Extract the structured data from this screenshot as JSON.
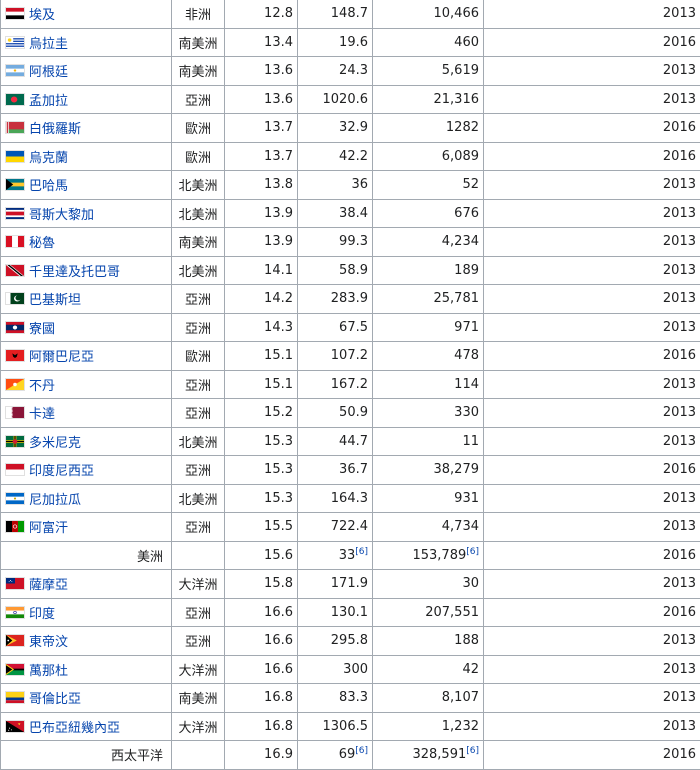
{
  "rows": [
    {
      "kind": "country",
      "name": "埃及",
      "flag": "egypt",
      "continent": "非洲",
      "v1": "12.8",
      "v2": "148.7",
      "v3": "10,466",
      "year": "2013"
    },
    {
      "kind": "country",
      "name": "烏拉圭",
      "flag": "uruguay",
      "continent": "南美洲",
      "v1": "13.4",
      "v2": "19.6",
      "v3": "460",
      "year": "2016"
    },
    {
      "kind": "country",
      "name": "阿根廷",
      "flag": "argentina",
      "continent": "南美洲",
      "v1": "13.6",
      "v2": "24.3",
      "v3": "5,619",
      "year": "2013"
    },
    {
      "kind": "country",
      "name": "孟加拉",
      "flag": "bangladesh",
      "continent": "亞洲",
      "v1": "13.6",
      "v2": "1020.6",
      "v3": "21,316",
      "year": "2013"
    },
    {
      "kind": "country",
      "name": "白俄羅斯",
      "flag": "belarus",
      "continent": "歐洲",
      "v1": "13.7",
      "v2": "32.9",
      "v3": "1282",
      "year": "2016"
    },
    {
      "kind": "country",
      "name": "烏克蘭",
      "flag": "ukraine",
      "continent": "歐洲",
      "v1": "13.7",
      "v2": "42.2",
      "v3": "6,089",
      "year": "2016"
    },
    {
      "kind": "country",
      "name": "巴哈馬",
      "flag": "bahamas",
      "continent": "北美洲",
      "v1": "13.8",
      "v2": "36",
      "v3": "52",
      "year": "2013"
    },
    {
      "kind": "country",
      "name": "哥斯大黎加",
      "flag": "costarica",
      "continent": "北美洲",
      "v1": "13.9",
      "v2": "38.4",
      "v3": "676",
      "year": "2013"
    },
    {
      "kind": "country",
      "name": "秘魯",
      "flag": "peru",
      "continent": "南美洲",
      "v1": "13.9",
      "v2": "99.3",
      "v3": "4,234",
      "year": "2013"
    },
    {
      "kind": "country",
      "name": "千里達及托巴哥",
      "flag": "trinidad",
      "continent": "北美洲",
      "v1": "14.1",
      "v2": "58.9",
      "v3": "189",
      "year": "2013"
    },
    {
      "kind": "country",
      "name": "巴基斯坦",
      "flag": "pakistan",
      "continent": "亞洲",
      "v1": "14.2",
      "v2": "283.9",
      "v3": "25,781",
      "year": "2013"
    },
    {
      "kind": "country",
      "name": "寮國",
      "flag": "laos",
      "continent": "亞洲",
      "v1": "14.3",
      "v2": "67.5",
      "v3": "971",
      "year": "2013"
    },
    {
      "kind": "country",
      "name": "阿爾巴尼亞",
      "flag": "albania",
      "continent": "歐洲",
      "v1": "15.1",
      "v2": "107.2",
      "v3": "478",
      "year": "2016"
    },
    {
      "kind": "country",
      "name": "不丹",
      "flag": "bhutan",
      "continent": "亞洲",
      "v1": "15.1",
      "v2": "167.2",
      "v3": "114",
      "year": "2013"
    },
    {
      "kind": "country",
      "name": "卡達",
      "flag": "qatar",
      "continent": "亞洲",
      "v1": "15.2",
      "v2": "50.9",
      "v3": "330",
      "year": "2013"
    },
    {
      "kind": "country",
      "name": "多米尼克",
      "flag": "dominica",
      "continent": "北美洲",
      "v1": "15.3",
      "v2": "44.7",
      "v3": "11",
      "year": "2013"
    },
    {
      "kind": "country",
      "name": "印度尼西亞",
      "flag": "indonesia",
      "continent": "亞洲",
      "v1": "15.3",
      "v2": "36.7",
      "v3": "38,279",
      "year": "2016"
    },
    {
      "kind": "country",
      "name": "尼加拉瓜",
      "flag": "nicaragua",
      "continent": "北美洲",
      "v1": "15.3",
      "v2": "164.3",
      "v3": "931",
      "year": "2013"
    },
    {
      "kind": "country",
      "name": "阿富汗",
      "flag": "afghanistan",
      "continent": "亞洲",
      "v1": "15.5",
      "v2": "722.4",
      "v3": "4,734",
      "year": "2013"
    },
    {
      "kind": "region",
      "name": "美洲",
      "v1": "15.6",
      "v2": "33",
      "v2ref": "[6]",
      "v3": "153,789",
      "v3ref": "[6]",
      "year": "2016"
    },
    {
      "kind": "country",
      "name": "薩摩亞",
      "flag": "samoa",
      "continent": "大洋洲",
      "v1": "15.8",
      "v2": "171.9",
      "v3": "30",
      "year": "2013"
    },
    {
      "kind": "country",
      "name": "印度",
      "flag": "india",
      "continent": "亞洲",
      "v1": "16.6",
      "v2": "130.1",
      "v3": "207,551",
      "year": "2016"
    },
    {
      "kind": "country",
      "name": "東帝汶",
      "flag": "easttimor",
      "continent": "亞洲",
      "v1": "16.6",
      "v2": "295.8",
      "v3": "188",
      "year": "2013"
    },
    {
      "kind": "country",
      "name": "萬那杜",
      "flag": "vanuatu",
      "continent": "大洋洲",
      "v1": "16.6",
      "v2": "300",
      "v3": "42",
      "year": "2013"
    },
    {
      "kind": "country",
      "name": "哥倫比亞",
      "flag": "colombia",
      "continent": "南美洲",
      "v1": "16.8",
      "v2": "83.3",
      "v3": "8,107",
      "year": "2013"
    },
    {
      "kind": "country",
      "name": "巴布亞紐幾內亞",
      "flag": "png",
      "continent": "大洋洲",
      "v1": "16.8",
      "v2": "1306.5",
      "v3": "1,232",
      "year": "2013"
    },
    {
      "kind": "region",
      "name": "西太平洋",
      "v1": "16.9",
      "v2": "69",
      "v2ref": "[6]",
      "v3": "328,591",
      "v3ref": "[6]",
      "year": "2016"
    }
  ]
}
